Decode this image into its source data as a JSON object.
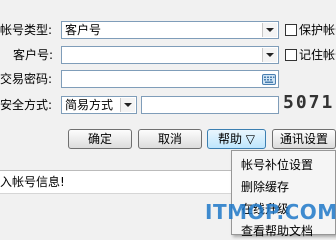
{
  "form": {
    "account_type_label": "帐号类型:",
    "account_type_value": "客户号",
    "save_account_label": "保护帐号",
    "customer_no_label": "客户号:",
    "customer_no_value": "",
    "remember_account_label": "记住帐号",
    "trade_password_label": "交易密码:",
    "trade_password_value": "",
    "security_mode_label": "安全方式:",
    "security_mode_value": "简易方式",
    "security_code_value": "",
    "captcha_text": "5071"
  },
  "buttons": {
    "ok": "确定",
    "cancel": "取消",
    "help": "帮助 ▽",
    "comm_settings": "通讯设置"
  },
  "status": {
    "message": "入帐号信息!"
  },
  "help_menu": {
    "items": [
      "帐号补位设置",
      "删除缓存",
      "在线升级",
      "查看帮助文档"
    ]
  },
  "watermark": "ITMOP.COM",
  "colors": {
    "field_border": "#7f9db9",
    "active_button": "#bee6fd",
    "watermark": "#1e78c8"
  }
}
